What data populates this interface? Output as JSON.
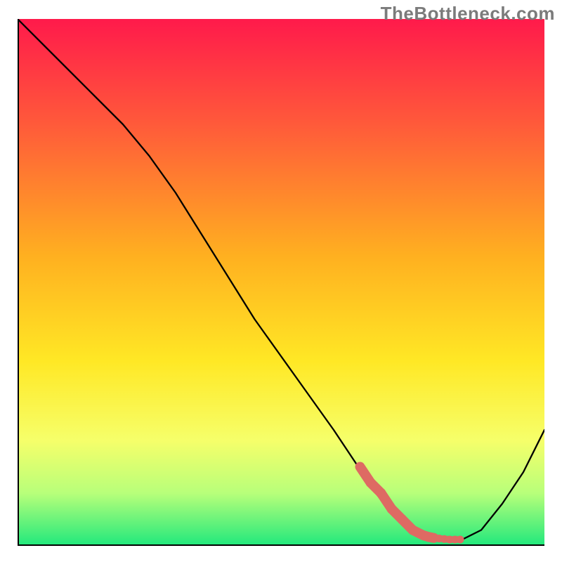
{
  "watermark": "TheBottleneck.com",
  "chart_data": {
    "type": "line",
    "title": "",
    "xlabel": "",
    "ylabel": "",
    "xlim": [
      0,
      100
    ],
    "ylim": [
      0,
      100
    ],
    "grid": false,
    "legend": false,
    "background_gradient": {
      "top_color": "#ff1a4b",
      "bottom_color": "#20e87c",
      "stops": [
        {
          "offset": 0.0,
          "color": "#ff1a4b"
        },
        {
          "offset": 0.2,
          "color": "#ff5a3a"
        },
        {
          "offset": 0.45,
          "color": "#ffb020"
        },
        {
          "offset": 0.65,
          "color": "#ffe825"
        },
        {
          "offset": 0.8,
          "color": "#f6ff6a"
        },
        {
          "offset": 0.9,
          "color": "#b8ff7a"
        },
        {
          "offset": 1.0,
          "color": "#20e87c"
        }
      ]
    },
    "axes_visible": "bottom-left-black-border",
    "series": [
      {
        "name": "bottleneck-curve",
        "color": "#000000",
        "x": [
          0,
          5,
          10,
          15,
          20,
          25,
          30,
          35,
          40,
          45,
          50,
          55,
          60,
          64,
          68,
          72,
          76,
          80,
          84,
          88,
          92,
          96,
          100
        ],
        "y": [
          100,
          95,
          90,
          85,
          80,
          74,
          67,
          59,
          51,
          43,
          36,
          29,
          22,
          16,
          10,
          5,
          2,
          1,
          1,
          3,
          8,
          14,
          22
        ]
      }
    ],
    "markers": {
      "name": "highlight-segment",
      "color": "#de6a63",
      "style": "thick-dotted-to-solid",
      "x": [
        65,
        67,
        69,
        71,
        73,
        75,
        77,
        78,
        79,
        80,
        81,
        82,
        83,
        84
      ],
      "y": [
        15,
        12,
        10,
        7,
        5,
        3,
        2,
        1.7,
        1.5,
        1.4,
        1.3,
        1.2,
        1.2,
        1.2
      ]
    }
  }
}
